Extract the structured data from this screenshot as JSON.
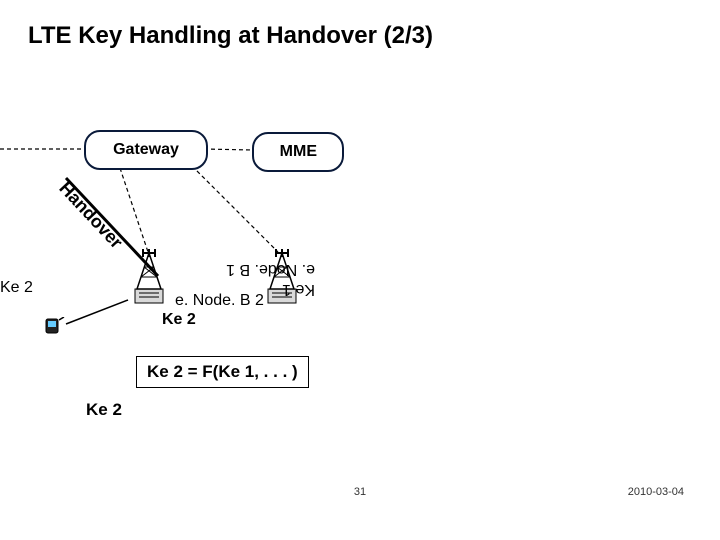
{
  "title": "LTE Key Handling at Handover (2/3)",
  "nodes": {
    "gateway": "Gateway",
    "mme": "MME"
  },
  "labels": {
    "handover": "Handover",
    "ke2_left": "Ke 2",
    "enodeb2": "e. Node. B 2",
    "ke2_below": "Ke 2",
    "enodeb1": "e. Node. B 1",
    "ke1": "Ke 1",
    "formula": "Ke 2 = F(Ke 1, . . . )",
    "ke2_low": "Ke 2"
  },
  "footer": {
    "page": "31",
    "date": "2010-03-04"
  }
}
